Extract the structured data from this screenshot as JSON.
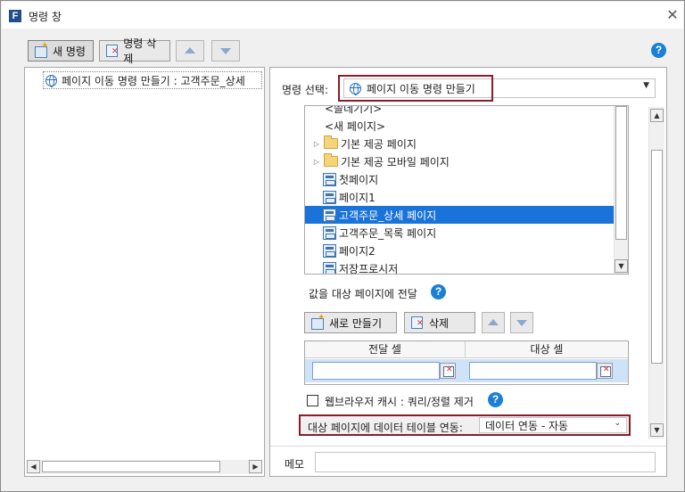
{
  "window": {
    "title": "명령 창",
    "app_icon_letter": "F"
  },
  "toolbar": {
    "new_label": "새 명령",
    "delete_label": "명령 삭제"
  },
  "left_panel": {
    "command_item": "페이지 이동 명령 만들기 : 고객주문_상세"
  },
  "command_select": {
    "label": "명령 선택:",
    "value": "페이지 이동 명령 만들기"
  },
  "page_tree": {
    "items": [
      {
        "label": "<쓸데기기>",
        "type": "text",
        "indent": 0
      },
      {
        "label": "<새 페이지>",
        "type": "text",
        "indent": 0
      },
      {
        "label": "기본 제공 페이지",
        "type": "folder",
        "indent": 0
      },
      {
        "label": "기본 제공 모바일 페이지",
        "type": "folder",
        "indent": 0
      },
      {
        "label": "첫페이지",
        "type": "page",
        "indent": 1
      },
      {
        "label": "페이지1",
        "type": "page",
        "indent": 1
      },
      {
        "label": "고객주문_상세 페이지",
        "type": "page",
        "indent": 1,
        "selected": true
      },
      {
        "label": "고객주문_목록 페이지",
        "type": "page",
        "indent": 1
      },
      {
        "label": "페이지2",
        "type": "page",
        "indent": 1
      },
      {
        "label": "저장프로시저",
        "type": "page",
        "indent": 1
      }
    ]
  },
  "pass_values": {
    "label": "값을 대상 페이지에 전달",
    "new_button": "새로 만들기",
    "delete_button": "삭제",
    "col_source": "전달 셀",
    "col_target": "대상 셀"
  },
  "browser_cache": {
    "label": "웹브라우저 캐시 : 쿼리/정렬 제거",
    "checked": false
  },
  "data_table_link": {
    "label": "대상 페이지에 데이터 테이블 연동:",
    "value": "데이터 연동 - 자동"
  },
  "memo": {
    "label": "메모",
    "value": ""
  },
  "colors": {
    "accent_red": "#8b1c2a",
    "selection_blue": "#1a73d9",
    "help_blue": "#1b7fd6"
  }
}
